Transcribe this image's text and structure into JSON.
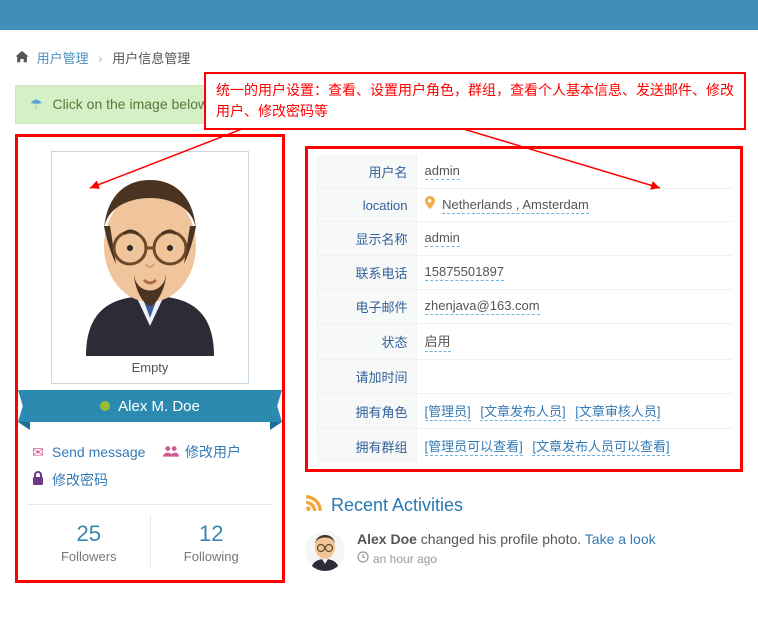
{
  "breadcrumb": {
    "root": "用户管理",
    "current": "用户信息管理"
  },
  "callout": "统一的用户设置：查看、设置用户角色，群组，查看个人基本信息、发送邮件、修改用户、修改密码等",
  "alert": {
    "text": "Click on the image below or on profile fields to edit them ...",
    "close": "×"
  },
  "profile": {
    "caption": "Empty",
    "name": "Alex M. Doe",
    "actions": {
      "send_message": "Send message",
      "edit_user": "修改用户",
      "change_password": "修改密码"
    },
    "stats": {
      "followers_count": "25",
      "followers_label": "Followers",
      "following_count": "12",
      "following_label": "Following"
    }
  },
  "info": {
    "labels": {
      "username": "用户名",
      "location": "location",
      "display_name": "显示名称",
      "phone": "联系电话",
      "email": "电子邮件",
      "status": "状态",
      "invite_time": "请加时间",
      "roles": "拥有角色",
      "groups": "拥有群组"
    },
    "values": {
      "username": "admin",
      "location": "Netherlands , Amsterdam",
      "display_name": "admin",
      "phone": "15875501897",
      "email": "zhenjava@163.com",
      "status": "启用",
      "invite_time": ""
    },
    "roles": [
      "[管理员]",
      "[文章发布人员]",
      "[文章审核人员]"
    ],
    "groups": [
      "[管理员可以查看]",
      "[文章发布人员可以查看]"
    ]
  },
  "activities": {
    "title": "Recent Activities",
    "item": {
      "user": "Alex Doe",
      "action": " changed his profile photo. ",
      "link": "Take a look",
      "time": "an hour ago"
    }
  }
}
